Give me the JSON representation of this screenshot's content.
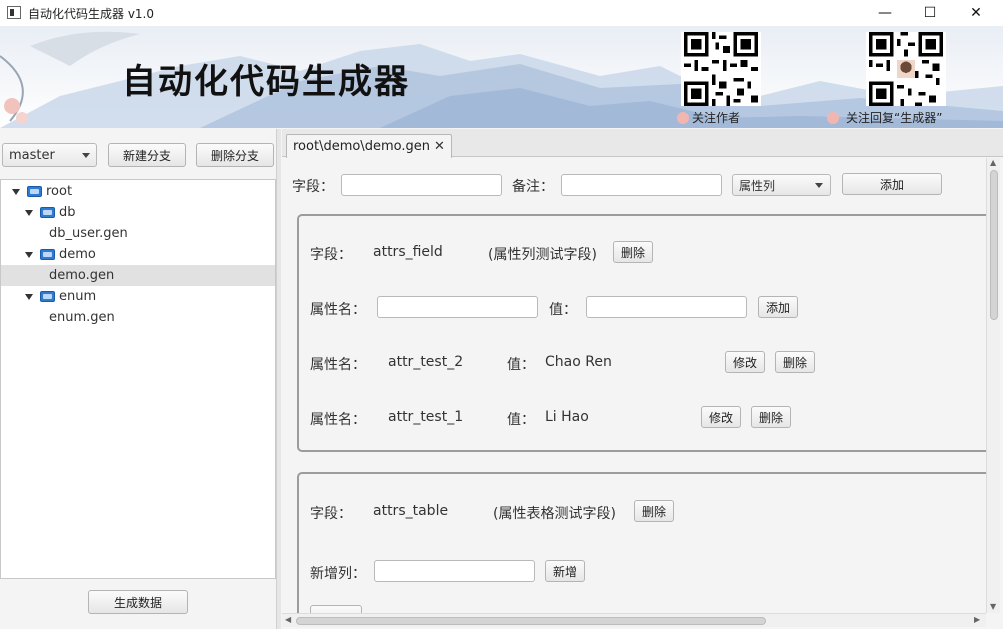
{
  "window": {
    "title": "自动化代码生成器 v1.0",
    "controls": {
      "minimize": "—",
      "maximize": "☐",
      "close": "✕"
    }
  },
  "banner": {
    "title": "自动化代码生成器",
    "qr_left_caption": "关注作者",
    "qr_right_caption": "关注回复“生成器”"
  },
  "left": {
    "branch": "master",
    "new_branch": "新建分支",
    "delete_branch": "删除分支",
    "tree": [
      {
        "label": "root",
        "level": 0,
        "folder": true
      },
      {
        "label": "db",
        "level": 1,
        "folder": true
      },
      {
        "label": "db_user.gen",
        "level": 2,
        "folder": false
      },
      {
        "label": "demo",
        "level": 1,
        "folder": true
      },
      {
        "label": "demo.gen",
        "level": 2,
        "folder": false,
        "selected": true
      },
      {
        "label": "enum",
        "level": 1,
        "folder": true
      },
      {
        "label": "enum.gen",
        "level": 2,
        "folder": false
      }
    ],
    "generate": "生成数据"
  },
  "tab": {
    "label": "root\\demo\\demo.gen",
    "close": "✕"
  },
  "form": {
    "field_label": "字段：",
    "note_label": "备注：",
    "type_select": "属性列",
    "add": "添加"
  },
  "card1": {
    "field_label": "字段：",
    "field_name": "attrs_field",
    "field_desc": "(属性列测试字段)",
    "delete": "删除",
    "attr_name_label": "属性名：",
    "value_label": "值：",
    "add": "添加",
    "attrs": [
      {
        "name": "attr_test_2",
        "value": "Chao Ren",
        "modify": "修改",
        "delete": "删除"
      },
      {
        "name": "attr_test_1",
        "value": "Li Hao",
        "modify": "修改",
        "delete": "删除"
      }
    ]
  },
  "card2": {
    "field_label": "字段：",
    "field_name": "attrs_table",
    "field_desc": "(属性表格测试字段)",
    "delete": "删除",
    "new_col_label": "新增列：",
    "new_col_button": "新增"
  }
}
